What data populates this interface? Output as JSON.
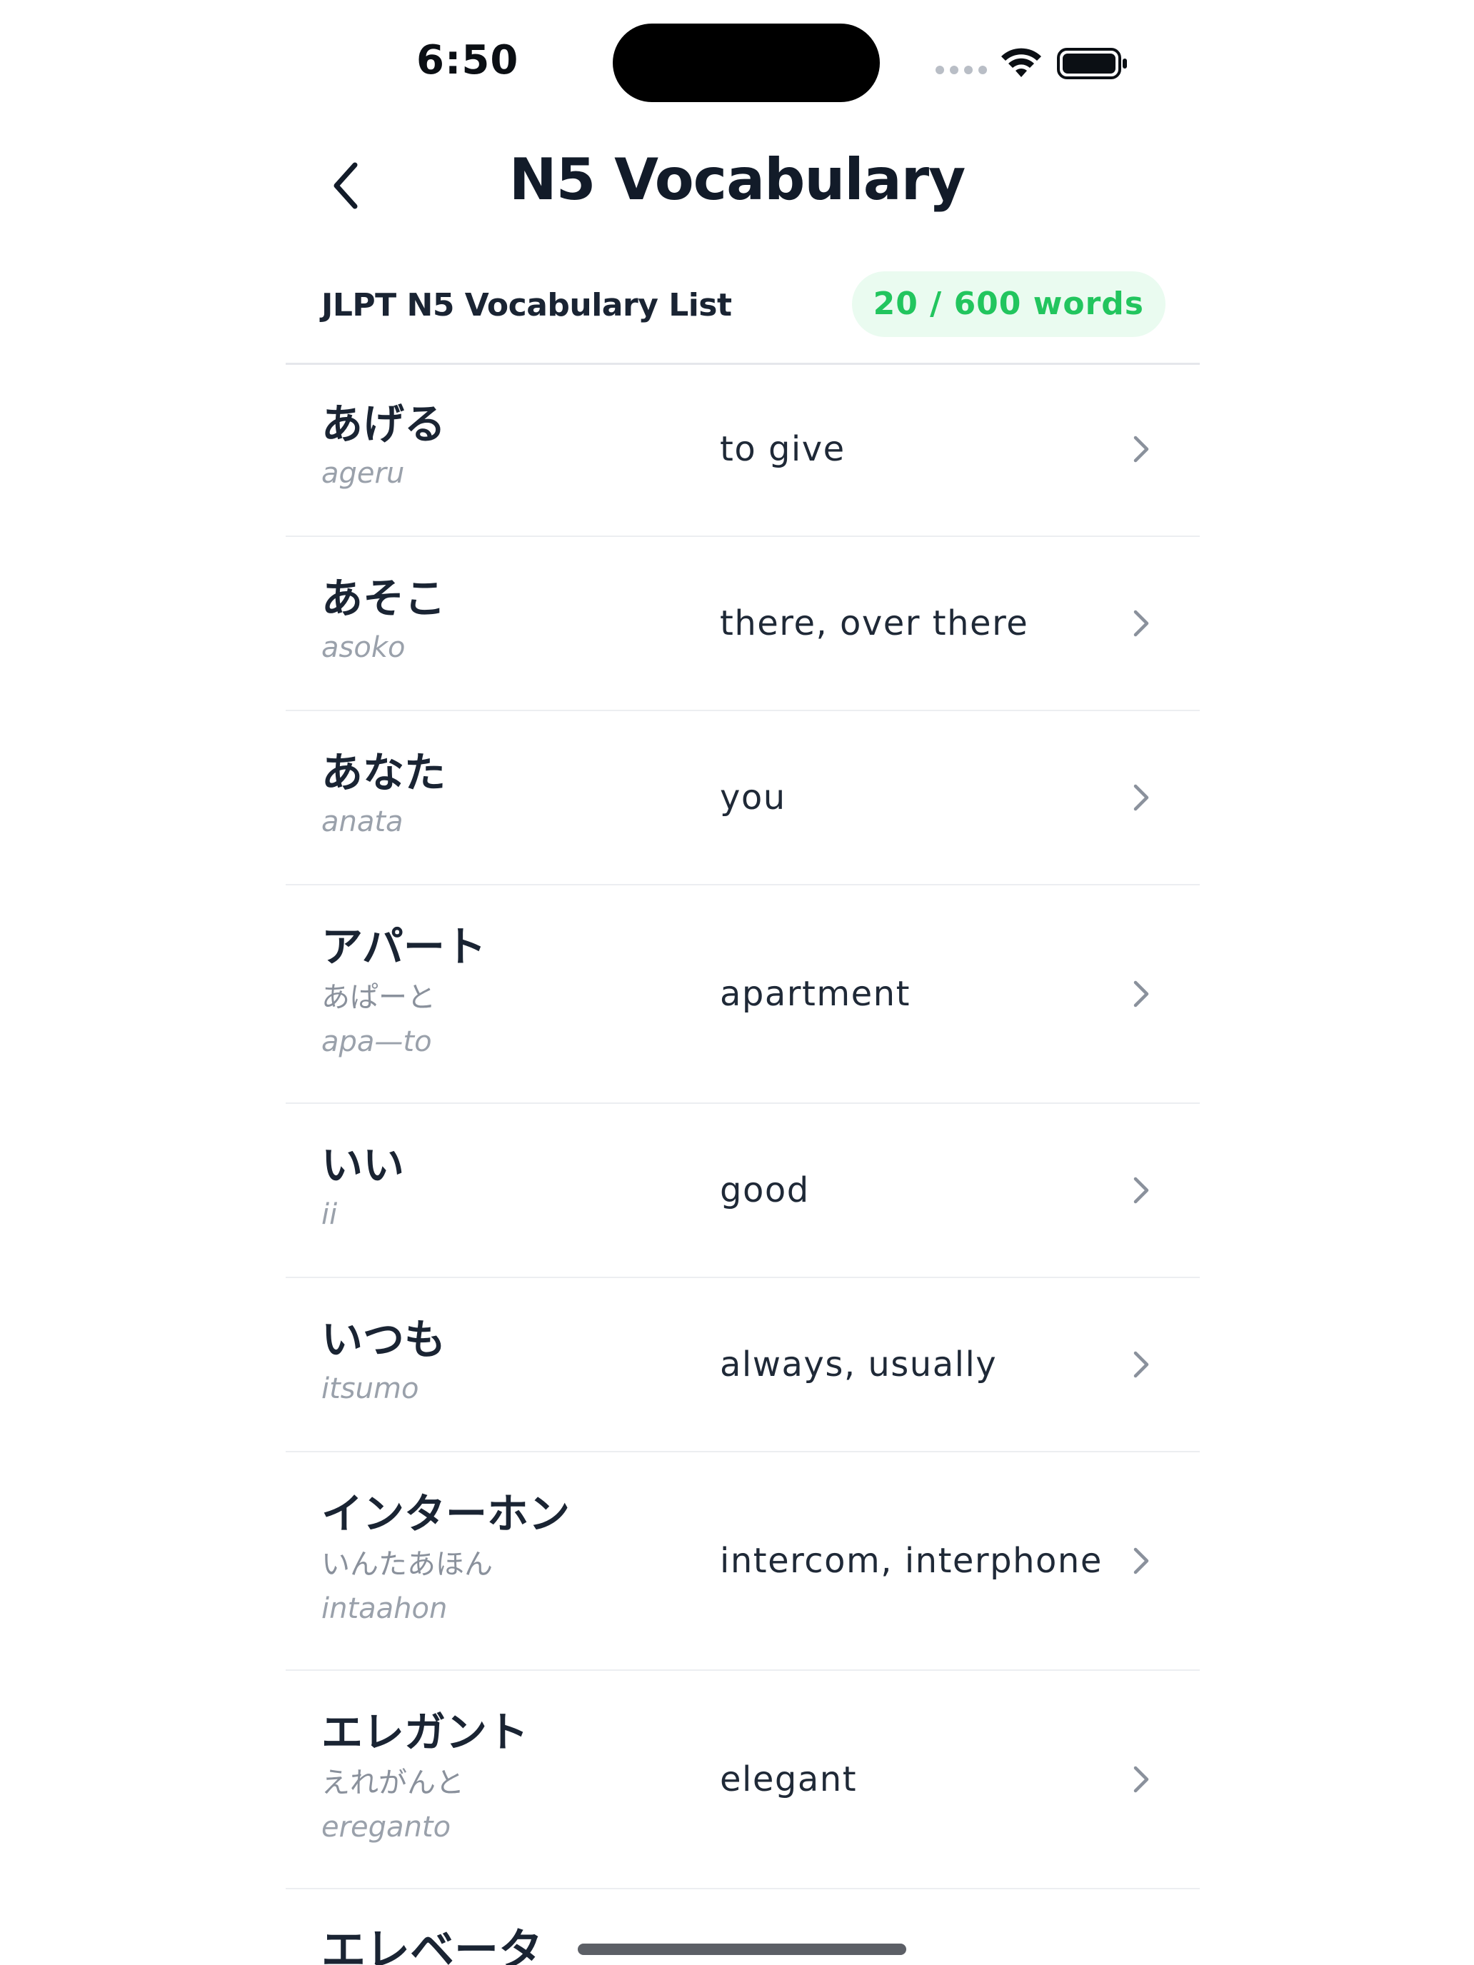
{
  "status_bar": {
    "time": "6:50"
  },
  "nav": {
    "back_icon": "chevron-left-icon",
    "title": "N5 Vocabulary"
  },
  "list_header": {
    "title": "JLPT N5 Vocabulary List",
    "count": "20 / 600 words"
  },
  "colors": {
    "accent_green": "#22c55e",
    "badge_bg": "#eafbf0"
  },
  "vocabulary": [
    {
      "word": "あげる",
      "reading": "",
      "romaji": "ageru",
      "meaning": "to give"
    },
    {
      "word": "あそこ",
      "reading": "",
      "romaji": "asoko",
      "meaning": "there, over there"
    },
    {
      "word": "あなた",
      "reading": "",
      "romaji": "anata",
      "meaning": "you"
    },
    {
      "word": "アパート",
      "reading": "あぱーと",
      "romaji": "apa—to",
      "meaning": "apartment"
    },
    {
      "word": "いい",
      "reading": "",
      "romaji": "ii",
      "meaning": "good"
    },
    {
      "word": "いつも",
      "reading": "",
      "romaji": "itsumo",
      "meaning": "always, usually"
    },
    {
      "word": "インターホン",
      "reading": "いんたあほん",
      "romaji": "intaahon",
      "meaning": "intercom, interphone"
    },
    {
      "word": "エレガント",
      "reading": "えれがんと",
      "romaji": "ereganto",
      "meaning": "elegant"
    }
  ],
  "partial_next_word": "エレベータ"
}
